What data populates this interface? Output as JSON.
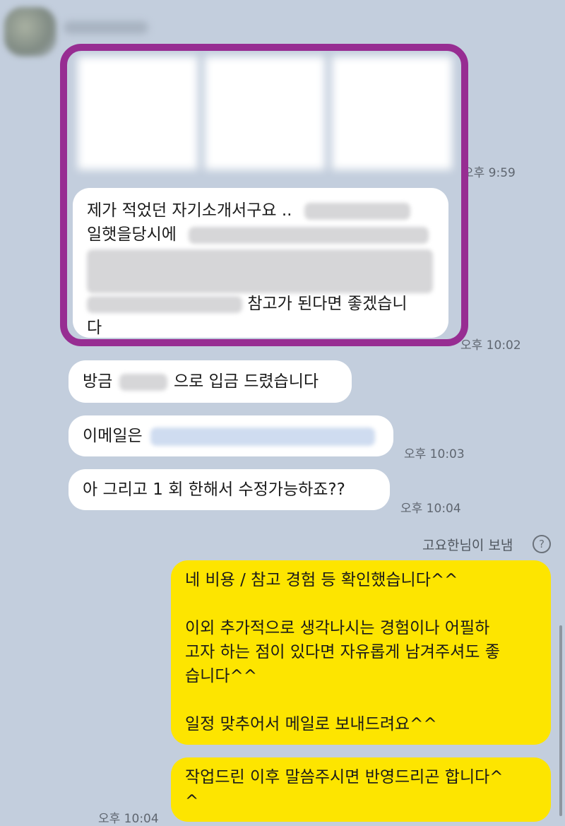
{
  "header": {
    "sender_name": ""
  },
  "messages": {
    "photo_time": "오후 9:59",
    "intro_line1": "제가 적었던 자기소개서구요 ..",
    "intro_line2": "일햇을당시에",
    "intro_line4": "참고가 된다면 좋겠습니",
    "intro_line5": "다",
    "intro_time": "오후 10:02",
    "deposit_prefix": "방금",
    "deposit_suffix": "으로 입금 드렸습니다",
    "email_label": "이메일은",
    "email_time": "오후 10:03",
    "revision_question": "아 그리고 1 회 한해서 수정가능하죠??",
    "revision_time": "오후 10:04",
    "sent_by": "고요한님이 보냄",
    "help_glyph": "?",
    "reply1": [
      "네 비용 / 참고 경험 등 확인했습니다^^",
      "",
      "이외 추가적으로 생각나시는 경험이나 어필하",
      "고자 하는 점이 있다면 자유롭게 남겨주셔도 좋",
      "습니다^^",
      "",
      "일정 맞추어서 메일로 보내드려요^^"
    ],
    "reply2": [
      "작업드린 이후 말씀주시면 반영드리곤 합니다^",
      "^"
    ],
    "reply_time": "오후 10:04"
  },
  "colors": {
    "background": "#c3cedd",
    "highlight": "#972d92",
    "my_bubble": "#fde500",
    "other_bubble": "#ffffff"
  }
}
